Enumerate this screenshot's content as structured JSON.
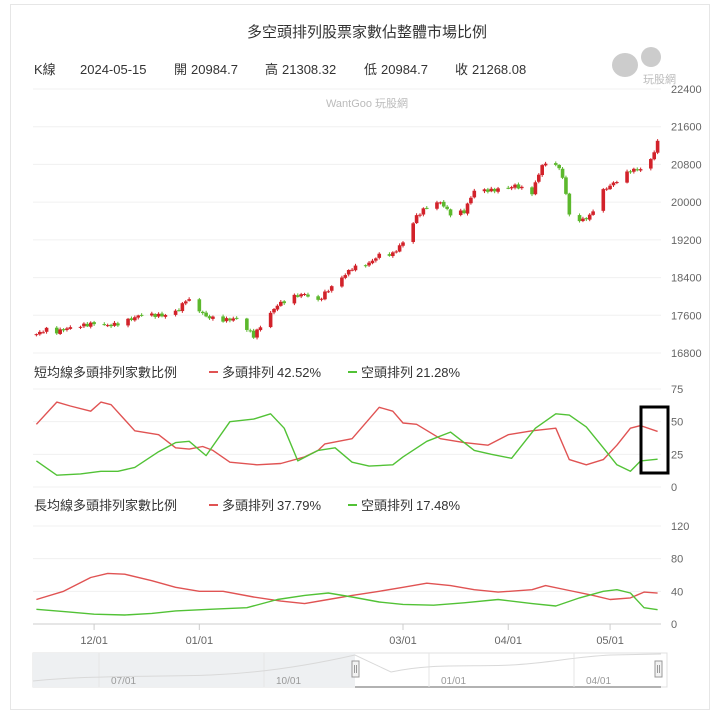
{
  "title": "多空頭排列股票家數佔整體市場比例",
  "watermark": "WantGoo 玩股網",
  "logo_text": "玩股網",
  "ohlc_header": {
    "series_label": "K線",
    "date": "2024-05-15",
    "open_label": "開",
    "open_value": "20984.7",
    "high_label": "高",
    "high_value": "21308.32",
    "low_label": "低",
    "low_value": "20984.7",
    "close_label": "收",
    "close_value": "21268.08"
  },
  "colors": {
    "up": "#d2222a",
    "down": "#5cb82d",
    "bull_line": "#e05353",
    "bear_line": "#52c236",
    "highlight": "#000000"
  },
  "chart_data": [
    {
      "type": "candlestick",
      "title": "K線",
      "yticks": [
        "16800",
        "17600",
        "18400",
        "19200",
        "20000",
        "20800",
        "21600",
        "22400"
      ],
      "ylim": [
        16800,
        22400
      ],
      "xticks": [
        "12/01",
        "01/01",
        "03/01",
        "04/01",
        "05/01"
      ],
      "series": [
        {
          "name": "K線",
          "close_path": [
            [
              "2023-11-14",
              17200
            ],
            [
              "2023-11-17",
              17300
            ],
            [
              "2023-11-20",
              17250
            ],
            [
              "2023-11-23",
              17320
            ],
            [
              "2023-11-27",
              17380
            ],
            [
              "2023-11-29",
              17400
            ],
            [
              "2023-12-01",
              17430
            ],
            [
              "2023-12-05",
              17380
            ],
            [
              "2023-12-08",
              17420
            ],
            [
              "2023-12-12",
              17520
            ],
            [
              "2023-12-15",
              17620
            ],
            [
              "2023-12-19",
              17600
            ],
            [
              "2023-12-22",
              17600
            ],
            [
              "2023-12-26",
              17720
            ],
            [
              "2023-12-28",
              17930
            ],
            [
              "2023-12-29",
              17910
            ],
            [
              "2024-01-03",
              17570
            ],
            [
              "2024-01-08",
              17500
            ],
            [
              "2024-01-12",
              17530
            ],
            [
              "2024-01-17",
              17160
            ],
            [
              "2024-01-19",
              17370
            ],
            [
              "2024-01-24",
              17820
            ],
            [
              "2024-01-29",
              18000
            ],
            [
              "2024-02-01",
              18050
            ],
            [
              "2024-02-05",
              17900
            ],
            [
              "2024-02-07",
              18070
            ],
            [
              "2024-02-15",
              18600
            ],
            [
              "2024-02-20",
              18700
            ],
            [
              "2024-02-23",
              18880
            ],
            [
              "2024-02-27",
              18900
            ],
            [
              "2024-03-01",
              19150
            ],
            [
              "2024-03-05",
              19700
            ],
            [
              "2024-03-08",
              19900
            ],
            [
              "2024-03-12",
              20000
            ],
            [
              "2024-03-15",
              19750
            ],
            [
              "2024-03-19",
              19800
            ],
            [
              "2024-03-22",
              20250
            ],
            [
              "2024-03-27",
              20250
            ],
            [
              "2024-04-01",
              20300
            ],
            [
              "2024-04-03",
              20350
            ],
            [
              "2024-04-08",
              20200
            ],
            [
              "2024-04-11",
              20790
            ],
            [
              "2024-04-15",
              20820
            ],
            [
              "2024-04-17",
              20550
            ],
            [
              "2024-04-19",
              19750
            ],
            [
              "2024-04-22",
              19600
            ],
            [
              "2024-04-25",
              19700
            ],
            [
              "2024-04-29",
              20250
            ],
            [
              "2024-05-02",
              20400
            ],
            [
              "2024-05-07",
              20670
            ],
            [
              "2024-05-10",
              20700
            ],
            [
              "2024-05-13",
              20900
            ],
            [
              "2024-05-15",
              21268
            ]
          ]
        }
      ]
    },
    {
      "type": "line",
      "title": "短均線多頭排列家數比例",
      "ylim": [
        0,
        75
      ],
      "yticks": [
        "0",
        "25",
        "50",
        "75"
      ],
      "series": [
        {
          "name": "多頭排列",
          "value_label": "42.52%",
          "points": [
            [
              "2023-11-14",
              48
            ],
            [
              "2023-11-20",
              65
            ],
            [
              "2023-11-24",
              62
            ],
            [
              "2023-11-30",
              58
            ],
            [
              "2023-12-03",
              65
            ],
            [
              "2023-12-06",
              63
            ],
            [
              "2023-12-13",
              43
            ],
            [
              "2023-12-20",
              40
            ],
            [
              "2023-12-25",
              30
            ],
            [
              "2023-12-29",
              29
            ],
            [
              "2024-01-02",
              31
            ],
            [
              "2024-01-05",
              28
            ],
            [
              "2024-01-10",
              19
            ],
            [
              "2024-01-18",
              17
            ],
            [
              "2024-01-25",
              18
            ],
            [
              "2024-02-01",
              23
            ],
            [
              "2024-02-05",
              28
            ],
            [
              "2024-02-07",
              33
            ],
            [
              "2024-02-15",
              37
            ],
            [
              "2024-02-20",
              52
            ],
            [
              "2024-02-23",
              61
            ],
            [
              "2024-02-27",
              58
            ],
            [
              "2024-03-01",
              49
            ],
            [
              "2024-03-05",
              48
            ],
            [
              "2024-03-12",
              37
            ],
            [
              "2024-03-19",
              34
            ],
            [
              "2024-03-26",
              32
            ],
            [
              "2024-04-01",
              40
            ],
            [
              "2024-04-08",
              43
            ],
            [
              "2024-04-15",
              45
            ],
            [
              "2024-04-19",
              21
            ],
            [
              "2024-04-24",
              17
            ],
            [
              "2024-04-29",
              21
            ],
            [
              "2024-05-03",
              32
            ],
            [
              "2024-05-07",
              45
            ],
            [
              "2024-05-10",
              47
            ],
            [
              "2024-05-15",
              42.52
            ]
          ]
        },
        {
          "name": "空頭排列",
          "value_label": "21.28%",
          "points": [
            [
              "2023-11-14",
              20
            ],
            [
              "2023-11-20",
              9
            ],
            [
              "2023-11-27",
              10
            ],
            [
              "2023-12-03",
              12
            ],
            [
              "2023-12-08",
              12
            ],
            [
              "2023-12-13",
              15
            ],
            [
              "2023-12-20",
              27
            ],
            [
              "2023-12-25",
              34
            ],
            [
              "2023-12-29",
              35
            ],
            [
              "2024-01-03",
              24
            ],
            [
              "2024-01-10",
              50
            ],
            [
              "2024-01-17",
              52
            ],
            [
              "2024-01-22",
              56
            ],
            [
              "2024-01-26",
              45
            ],
            [
              "2024-01-30",
              20
            ],
            [
              "2024-02-05",
              28
            ],
            [
              "2024-02-10",
              30
            ],
            [
              "2024-02-15",
              19
            ],
            [
              "2024-02-20",
              16
            ],
            [
              "2024-02-27",
              17
            ],
            [
              "2024-03-01",
              23
            ],
            [
              "2024-03-08",
              35
            ],
            [
              "2024-03-15",
              42
            ],
            [
              "2024-03-22",
              28
            ],
            [
              "2024-03-27",
              25
            ],
            [
              "2024-04-02",
              22
            ],
            [
              "2024-04-09",
              45
            ],
            [
              "2024-04-15",
              56
            ],
            [
              "2024-04-19",
              55
            ],
            [
              "2024-04-24",
              46
            ],
            [
              "2024-04-29",
              30
            ],
            [
              "2024-05-03",
              17
            ],
            [
              "2024-05-07",
              12
            ],
            [
              "2024-05-10",
              20
            ],
            [
              "2024-05-15",
              21.28
            ]
          ]
        }
      ]
    },
    {
      "type": "line",
      "title": "長均線多頭排列家數比例",
      "ylim": [
        0,
        120
      ],
      "yticks": [
        "0",
        "40",
        "80",
        "120"
      ],
      "series": [
        {
          "name": "多頭排列",
          "value_label": "37.79%",
          "points": [
            [
              "2023-11-14",
              30
            ],
            [
              "2023-11-22",
              40
            ],
            [
              "2023-11-30",
              57
            ],
            [
              "2023-12-05",
              62
            ],
            [
              "2023-12-10",
              61
            ],
            [
              "2023-12-18",
              53
            ],
            [
              "2023-12-25",
              45
            ],
            [
              "2024-01-01",
              40
            ],
            [
              "2024-01-08",
              40
            ],
            [
              "2024-01-17",
              33
            ],
            [
              "2024-01-25",
              28
            ],
            [
              "2024-02-01",
              25
            ],
            [
              "2024-02-08",
              30
            ],
            [
              "2024-02-15",
              35
            ],
            [
              "2024-02-23",
              40
            ],
            [
              "2024-03-01",
              45
            ],
            [
              "2024-03-08",
              50
            ],
            [
              "2024-03-15",
              47
            ],
            [
              "2024-03-22",
              42
            ],
            [
              "2024-03-29",
              39
            ],
            [
              "2024-04-08",
              42
            ],
            [
              "2024-04-12",
              47
            ],
            [
              "2024-04-19",
              41
            ],
            [
              "2024-04-26",
              35
            ],
            [
              "2024-05-01",
              30
            ],
            [
              "2024-05-07",
              32
            ],
            [
              "2024-05-11",
              39
            ],
            [
              "2024-05-15",
              37.79
            ]
          ]
        },
        {
          "name": "空頭排列",
          "value_label": "17.48%",
          "points": [
            [
              "2023-11-14",
              18
            ],
            [
              "2023-11-23",
              15
            ],
            [
              "2023-12-01",
              12
            ],
            [
              "2023-12-10",
              11
            ],
            [
              "2023-12-18",
              13
            ],
            [
              "2023-12-25",
              16
            ],
            [
              "2024-01-04",
              18
            ],
            [
              "2024-01-15",
              20
            ],
            [
              "2024-01-24",
              30
            ],
            [
              "2024-02-01",
              35
            ],
            [
              "2024-02-08",
              38
            ],
            [
              "2024-02-15",
              33
            ],
            [
              "2024-02-23",
              27
            ],
            [
              "2024-03-01",
              24
            ],
            [
              "2024-03-10",
              23
            ],
            [
              "2024-03-19",
              26
            ],
            [
              "2024-03-29",
              30
            ],
            [
              "2024-04-08",
              25
            ],
            [
              "2024-04-15",
              22
            ],
            [
              "2024-04-22",
              32
            ],
            [
              "2024-04-29",
              40
            ],
            [
              "2024-05-03",
              42
            ],
            [
              "2024-05-07",
              38
            ],
            [
              "2024-05-11",
              20
            ],
            [
              "2024-05-15",
              17.48
            ]
          ]
        }
      ]
    }
  ],
  "navigator": {
    "labels": [
      "07/01",
      "10/01",
      "01/01",
      "04/01"
    ]
  }
}
